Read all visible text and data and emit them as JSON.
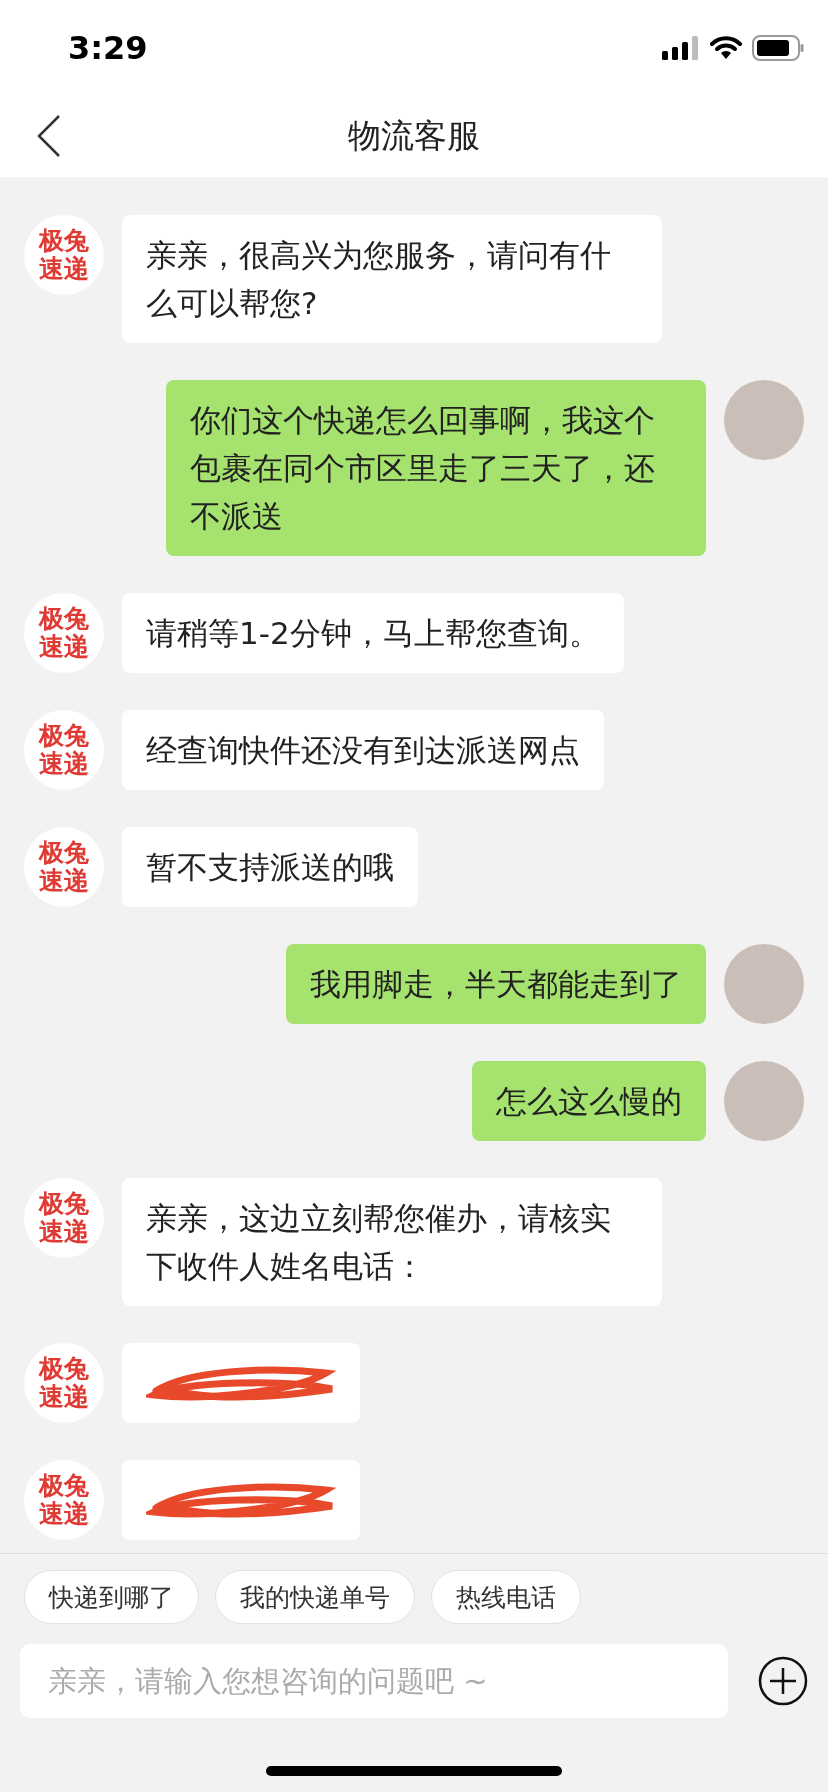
{
  "status_bar": {
    "time": "3:29"
  },
  "header": {
    "title": "物流客服"
  },
  "messages": [
    {
      "kind": "received",
      "avatar": [
        "极兔",
        "速递"
      ],
      "text": "亲亲，很高兴为您服务，请问有什么可以帮您?"
    },
    {
      "kind": "sent",
      "text": "你们这个快递怎么回事啊，我这个包裹在同个市区里走了三天了，还不派送"
    },
    {
      "kind": "received",
      "avatar": [
        "极兔",
        "速递"
      ],
      "text": "请稍等1-2分钟，马上帮您查询。"
    },
    {
      "kind": "received",
      "avatar": [
        "极兔",
        "速递"
      ],
      "text": "经查询快件还没有到达派送网点"
    },
    {
      "kind": "received",
      "avatar": [
        "极兔",
        "速递"
      ],
      "text": "暂不支持派送的哦"
    },
    {
      "kind": "sent",
      "text": "我用脚走，半天都能走到了"
    },
    {
      "kind": "sent",
      "text": "怎么这么慢的"
    },
    {
      "kind": "received",
      "avatar": [
        "极兔",
        "速递"
      ],
      "text": "亲亲，这边立刻帮您催办，请核实下收件人姓名电话："
    },
    {
      "kind": "redacted",
      "avatar": [
        "极兔",
        "速递"
      ]
    },
    {
      "kind": "redacted",
      "avatar": [
        "极兔",
        "速递"
      ]
    }
  ],
  "quick_replies": [
    "快递到哪了",
    "我的快递单号",
    "热线电话"
  ],
  "input": {
    "placeholder": "亲亲，请输入您想咨询的问题吧 ~"
  }
}
